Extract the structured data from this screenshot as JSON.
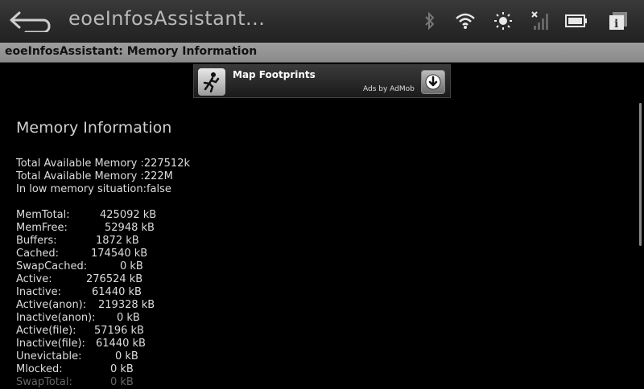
{
  "topbar": {
    "app_title": "eoeInfosAssistant..."
  },
  "titlebar": {
    "title": "eoeInfosAssistant: Memory Information"
  },
  "ad": {
    "title": "Map Footprints",
    "by": "Ads by AdMob"
  },
  "main": {
    "heading": "Memory Information",
    "summary": [
      "Total Available Memory :227512k",
      "Total Available Memory :222M",
      "In low memory situation:false"
    ],
    "rows": [
      {
        "label": "MemTotal:",
        "value": "425092 kB"
      },
      {
        "label": "MemFree:",
        "value": "52948 kB"
      },
      {
        "label": "Buffers:",
        "value": "1872 kB"
      },
      {
        "label": "Cached:",
        "value": "174540 kB"
      },
      {
        "label": "SwapCached:",
        "value": "0 kB"
      },
      {
        "label": "Active:",
        "value": "276524 kB"
      },
      {
        "label": "Inactive:",
        "value": "61440 kB"
      },
      {
        "label": "Active(anon):",
        "value": "219328 kB"
      },
      {
        "label": "Inactive(anon):",
        "value": "0 kB"
      },
      {
        "label": "Active(file):",
        "value": "57196 kB"
      },
      {
        "label": "Inactive(file):",
        "value": "61440 kB"
      },
      {
        "label": "Unevictable:",
        "value": "0 kB"
      },
      {
        "label": "Mlocked:",
        "value": "0 kB"
      },
      {
        "label": "SwapTotal:",
        "value": "0 kB"
      }
    ]
  }
}
